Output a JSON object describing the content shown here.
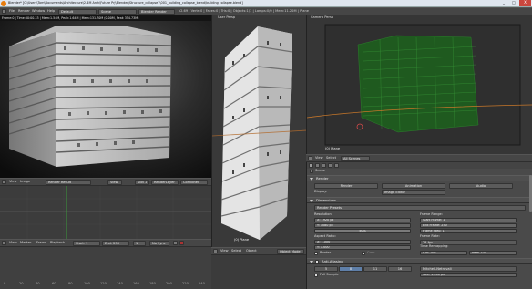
{
  "window": {
    "title": "Blender* [C:\\Users\\Tom\\Documents\\Architecture\\2-4M Arch\\Future Prj\\Blender\\Structure_collapse7\\001_building_collapse_blend\\building collapse.blend]",
    "min": "_",
    "max": "□",
    "close": "X"
  },
  "topbar": {
    "menus": [
      "File",
      "Render",
      "Window",
      "Help"
    ],
    "layout": "Default",
    "scene": "Scene",
    "engine": "Blender Render",
    "info": "v2.69 | Verts:0 | Faces:0 | Tris:0 | Objects:1/1 | Lamps:0/0 | Mem:11.22M | Plane"
  },
  "render_view": {
    "stats": "Frame:0 | Time:00:00.33 | Mem:1.54M, Peak:1.64M | Mem:131.70M (0.00M, Peak 354.73M)",
    "menus": [
      "View",
      "Image"
    ],
    "image_name": "Render Result",
    "slot": "Slot 1",
    "layer": "RenderLayer",
    "pass": "Combined",
    "timeline_menus": [
      "View",
      "Marker",
      "Frame",
      "Playback"
    ],
    "start": "Start: 1",
    "end": "End: 250",
    "current": "1",
    "sync": "No Sync",
    "ruler": [
      "0",
      "20",
      "40",
      "60",
      "80",
      "100",
      "120",
      "140",
      "160",
      "180",
      "200",
      "220",
      "240"
    ]
  },
  "user_persp": {
    "label": "User Persp",
    "object": "(0) Plane",
    "menus": [
      "View",
      "Select",
      "Object"
    ],
    "mode": "Object Mode"
  },
  "camera_persp": {
    "label": "Camera Persp",
    "object": "(0) Plane",
    "menus": [
      "View",
      "Select",
      "Add",
      "Object"
    ],
    "mode": "Object Mode",
    "orientation": "Global"
  },
  "properties": {
    "menus": [
      "View",
      "Select",
      "All Scenes"
    ],
    "path": "Scene",
    "sections": {
      "render": "Render",
      "dimensions": "Dimensions",
      "antialiasing": "Anti-Aliasing"
    },
    "buttons": {
      "render": "Render",
      "animation": "Animation",
      "audio": "Audio"
    },
    "display": {
      "label": "Display:",
      "value": "Image Editor"
    },
    "presets": "Render Presets",
    "resolution": {
      "label": "Resolution:",
      "x": "X: 1920 px",
      "y": "Y: 1080 px",
      "pct": "50%"
    },
    "frame_range": {
      "label": "Frame Range:",
      "start": "Start Frame: 1",
      "end": "End Frame: 250",
      "step": "Frame Step: 1"
    },
    "aspect": {
      "label": "Aspect Ratio:",
      "x": "X: 1.000",
      "y": "Y: 1.000"
    },
    "frame_rate": {
      "label": "Frame Rate:",
      "value": "24 fps"
    },
    "border": "Border",
    "crop": "Crop",
    "time_remap": {
      "label": "Time Remapping:",
      "old": "Old: 100",
      "new": "New: 100"
    },
    "aa_samples": [
      "5",
      "8",
      "11",
      "16"
    ],
    "aa_filter": "Mitchell-Netravali",
    "full_sample": "Full Sample",
    "size": "Size: 1.000 px"
  }
}
